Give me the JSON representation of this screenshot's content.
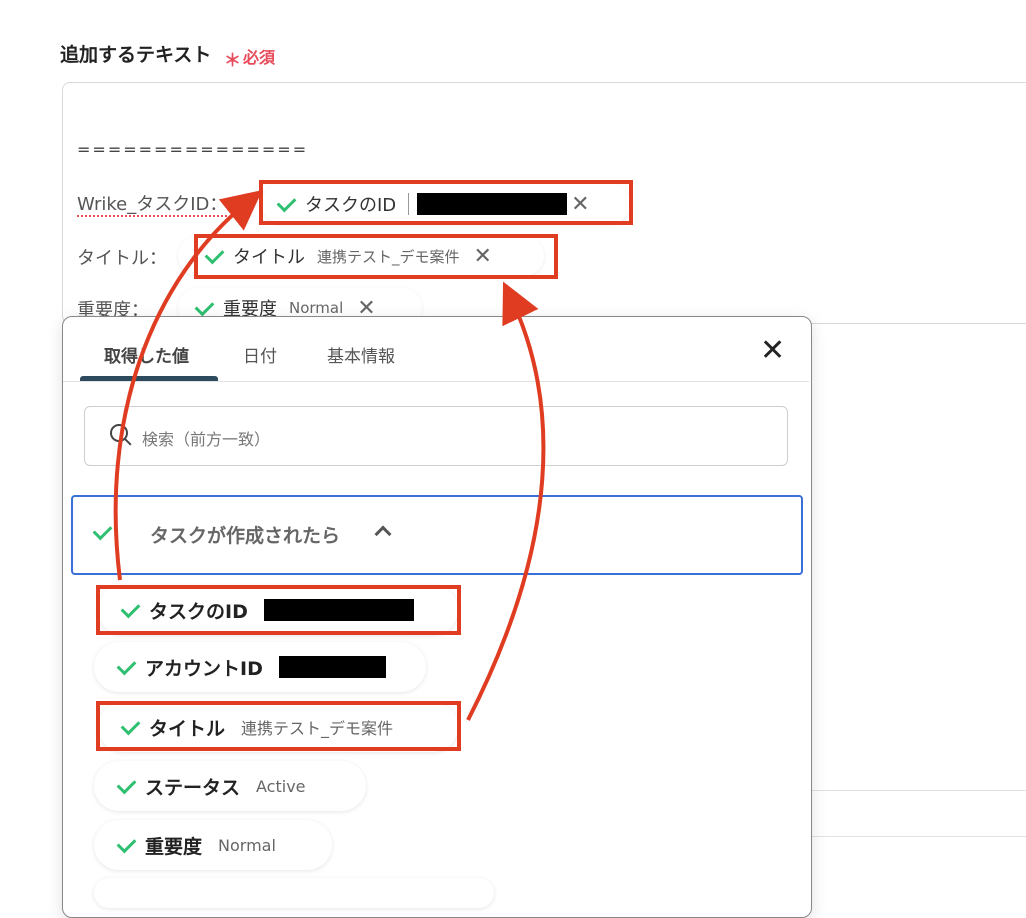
{
  "form": {
    "label": "追加するテキスト",
    "required_mark": "＊",
    "required_text": "必須"
  },
  "editor": {
    "separator": "===============",
    "lines": [
      {
        "label": "Wrike_タスクID：",
        "token": {
          "name": "タスクのID",
          "value": "",
          "redacted": true
        }
      },
      {
        "label": "タイトル：",
        "token": {
          "name": "タイトル",
          "value": "連携テスト_デモ案件"
        }
      },
      {
        "label": "重要度：",
        "token": {
          "name": "重要度",
          "value": "Normal"
        }
      }
    ],
    "token_icon": "check-icon",
    "remove_icon": "close-icon",
    "remove_glyph": "✕"
  },
  "panel": {
    "tabs": [
      {
        "label": "取得した値",
        "active": true
      },
      {
        "label": "日付"
      },
      {
        "label": "基本情報"
      }
    ],
    "close_glyph": "✕",
    "search": {
      "placeholder": "検索（前方一致）"
    },
    "group": {
      "label": "タスクが作成されたら",
      "expanded": true
    },
    "items": [
      {
        "name": "タスクのID",
        "value": "",
        "redacted": true,
        "highlighted": true
      },
      {
        "name": "アカウントID",
        "value": "",
        "redacted": true
      },
      {
        "name": "タイトル",
        "value": "連携テスト_デモ案件",
        "highlighted": true
      },
      {
        "name": "ステータス",
        "value": "Active"
      },
      {
        "name": "重要度",
        "value": "Normal"
      }
    ]
  },
  "colors": {
    "accent_red": "#e03c22",
    "required_red": "#e74c5b",
    "check_green": "#2fbf71",
    "group_border_blue": "#3a6fd8",
    "tab_indicator": "#2e4a5e"
  }
}
